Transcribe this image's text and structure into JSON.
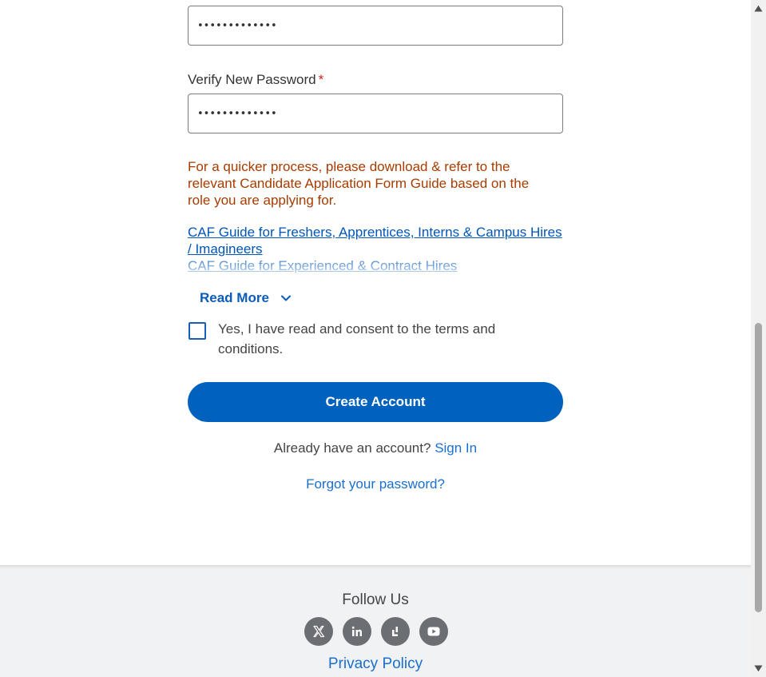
{
  "form": {
    "new_password_value": "•••••••••••••",
    "verify_label": "Verify New Password",
    "required_mark": "*",
    "verify_password_value": "•••••••••••••",
    "notice": "For a quicker process, please download & refer to the relevant Candidate Application Form Guide based on the role you are applying for.",
    "guides": [
      {
        "label": "CAF Guide for Freshers, Apprentices, Interns & Campus Hires / Imagineers"
      },
      {
        "label": "CAF Guide for Experienced & Contract Hires"
      }
    ],
    "read_more_label": "Read More",
    "consent_label": "Yes, I have read and consent to the terms and conditions.",
    "create_account_label": "Create Account",
    "have_account_text": "Already have an account?",
    "sign_in_label": "Sign In",
    "forgot_password_label": "Forgot your password?"
  },
  "footer": {
    "follow_title": "Follow Us",
    "socials": [
      {
        "icon": "x-twitter-icon"
      },
      {
        "icon": "linkedin-icon"
      },
      {
        "icon": "glassdoor-icon"
      },
      {
        "icon": "youtube-icon"
      }
    ],
    "privacy_label": "Privacy Policy"
  },
  "colors": {
    "accent": "#0062be",
    "link": "#1a6fcf",
    "notice": "#a83c00",
    "required": "#d81c1c",
    "social_bg": "#6b6e72",
    "footer_bg": "#f1f2f3"
  },
  "scrollbar": {
    "up_icon": "scroll-up-arrow-icon",
    "down_icon": "scroll-down-arrow-icon"
  }
}
